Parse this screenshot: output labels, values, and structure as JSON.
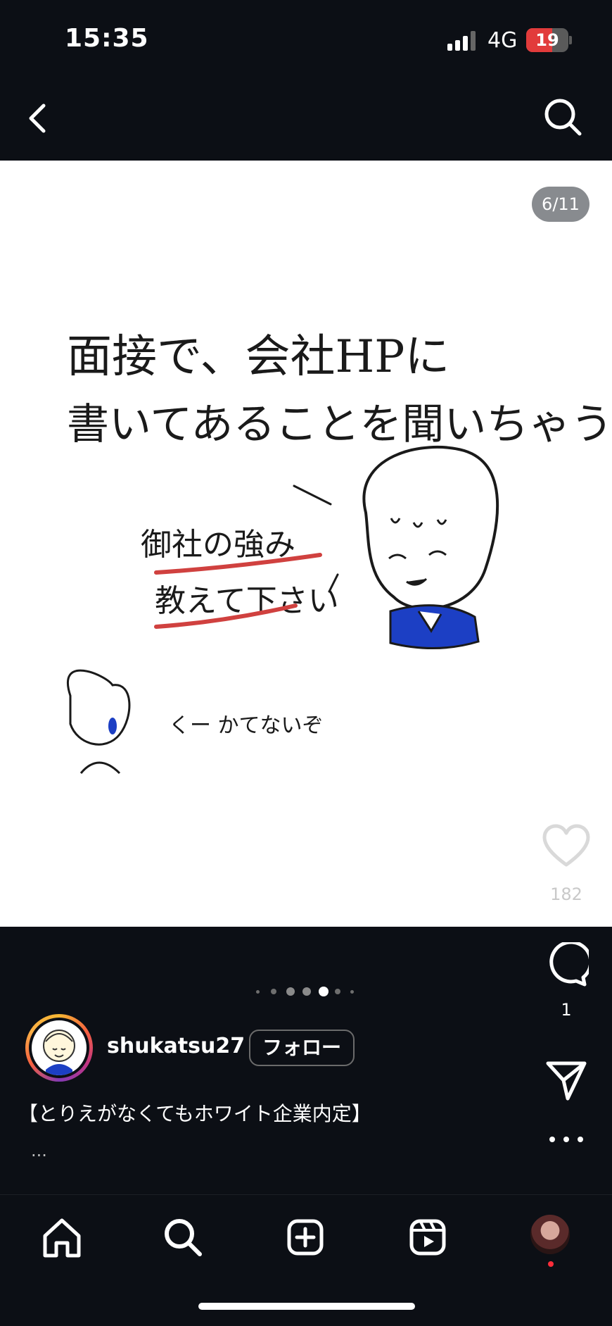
{
  "status_bar": {
    "time": "15:35",
    "network": "4G",
    "battery_level": "19",
    "battery_color": "#e23b3b"
  },
  "top_nav": {
    "back_icon": "chevron-left-icon",
    "search_icon": "search-icon"
  },
  "post": {
    "counter": "6/11",
    "illustration": {
      "line1": "面接で、会社HPに",
      "line2": "書いてあることを聞いちゃう",
      "speech_line1": "御社の強み",
      "speech_line2": "教えて下さい",
      "aside": "くー かてないぞ"
    },
    "carousel_total": 7,
    "carousel_active": 4
  },
  "actions": {
    "like_icon": "heart-icon",
    "like_count": "182",
    "comment_icon": "comment-icon",
    "comment_count": "1",
    "share_icon": "send-icon",
    "more_icon": "more-icon"
  },
  "author": {
    "username": "shukatsu27",
    "follow_label": "フォロー"
  },
  "caption": {
    "text": "【とりえがなくてもホワイト企業内定】",
    "more": "..."
  },
  "bottom_nav": {
    "items": [
      "home-icon",
      "search-icon",
      "create-icon",
      "reels-icon",
      "profile-avatar"
    ]
  }
}
